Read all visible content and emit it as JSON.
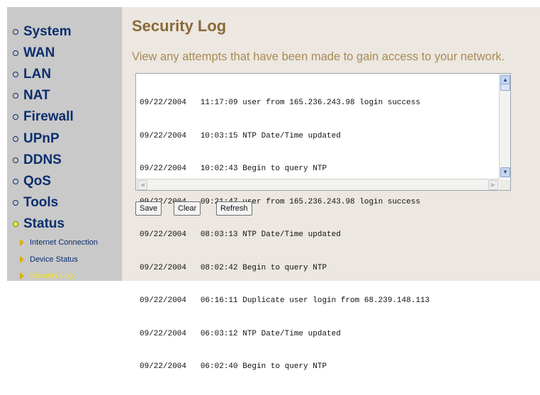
{
  "sidebar": {
    "items": [
      {
        "label": "System"
      },
      {
        "label": "WAN"
      },
      {
        "label": "LAN"
      },
      {
        "label": "NAT"
      },
      {
        "label": "Firewall"
      },
      {
        "label": "UPnP"
      },
      {
        "label": "DDNS"
      },
      {
        "label": "QoS"
      },
      {
        "label": "Tools"
      },
      {
        "label": "Status",
        "active": true
      }
    ],
    "subitems": [
      {
        "label": "Internet Connection"
      },
      {
        "label": "Device Status"
      },
      {
        "label": "Security Log",
        "active": true
      }
    ]
  },
  "main": {
    "title": "Security Log",
    "description": "View any attempts that have been made to gain access to your network.",
    "log": [
      "09/22/2004   11:17:09 user from 165.236.243.98 login success",
      "09/22/2004   10:03:15 NTP Date/Time updated",
      "09/22/2004   10:02:43 Begin to query NTP",
      "09/22/2004   09:21:47 user from 165.236.243.98 login success",
      "09/22/2004   08:03:13 NTP Date/Time updated",
      "09/22/2004   08:02:42 Begin to query NTP",
      "09/22/2004   06:16:11 Duplicate user login from 68.239.148.113",
      "09/22/2004   06:03:12 NTP Date/Time updated",
      "09/22/2004   06:02:40 Begin to query NTP"
    ],
    "buttons": {
      "save": "Save",
      "clear": "Clear",
      "refresh": "Refresh"
    }
  },
  "colors": {
    "sidebar_bg": "#c9c9c9",
    "main_bg": "#ece7e0",
    "nav_text": "#0b2e6e",
    "title": "#8a6a38",
    "active_sub": "#f0e12a"
  }
}
